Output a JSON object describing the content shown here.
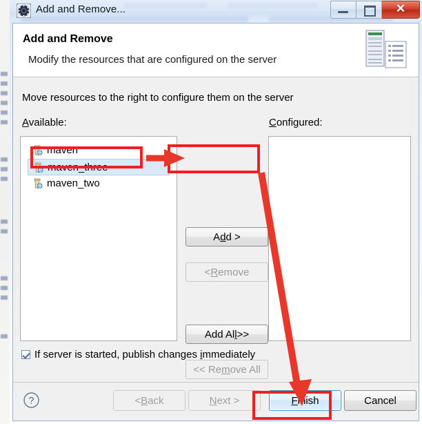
{
  "window": {
    "title": "Add and Remove...",
    "icon": "gear-icon",
    "controls": {
      "minimize": "minimize-icon",
      "maximize": "maximize-icon",
      "close": "✕"
    }
  },
  "header": {
    "title": "Add and Remove",
    "subtitle": "Modify the resources that are configured on the server",
    "icon": "server-resources-icon"
  },
  "main": {
    "instruction": "Move resources to the right to configure them on the server",
    "available": {
      "label": "Available:",
      "label_mnemonic": "A",
      "items": [
        {
          "name": "maven",
          "icon": "project-icon",
          "selected": false
        },
        {
          "name": "maven_three",
          "icon": "project-icon",
          "selected": true
        },
        {
          "name": "maven_two",
          "icon": "project-icon",
          "selected": false
        }
      ]
    },
    "configured": {
      "label": "Configured:",
      "label_mnemonic": "C",
      "items": []
    },
    "transfer_buttons": [
      {
        "label_pre": "A",
        "label_mnemonic": "d",
        "label_post": "d >",
        "full": "Add >",
        "enabled": true
      },
      {
        "label_pre": "< ",
        "label_mnemonic": "R",
        "label_post": "emove",
        "full": "< Remove",
        "enabled": false
      },
      {
        "label_pre": "Add Al",
        "label_mnemonic": "l",
        "label_post": " >>",
        "full": "Add All >>",
        "enabled": true
      },
      {
        "label_pre": "<< Re",
        "label_mnemonic": "m",
        "label_post": "ove All",
        "full": "<< Remove All",
        "enabled": false
      }
    ],
    "publish_checkbox": {
      "checked": true,
      "text_pre": "If server is started, publish changes ",
      "text_mnemonic": "i",
      "text_post": "mmediately",
      "full": "If server is started, publish changes immediately"
    }
  },
  "footer": {
    "help": "?",
    "buttons": [
      {
        "label_pre": "< ",
        "label_mnemonic": "B",
        "label_post": "ack",
        "full": "< Back",
        "enabled": false,
        "default": false
      },
      {
        "label_pre": "",
        "label_mnemonic": "N",
        "label_post": "ext >",
        "full": "Next >",
        "enabled": false,
        "default": false
      },
      {
        "label_pre": "",
        "label_mnemonic": "F",
        "label_post": "inish",
        "full": "Finish",
        "enabled": true,
        "default": true
      },
      {
        "label_pre": "Cancel",
        "label_mnemonic": "",
        "label_post": "",
        "full": "Cancel",
        "enabled": true,
        "default": false
      }
    ]
  },
  "annotations": {
    "highlight_boxes": [
      {
        "target": "maven_three list item",
        "color": "#f02020"
      },
      {
        "target": "Add > button",
        "color": "#f02020"
      },
      {
        "target": "Finish button",
        "color": "#f02020"
      }
    ],
    "arrows": [
      {
        "from": "maven_three",
        "to": "Add > button",
        "color": "#f02020"
      },
      {
        "from": "Add > button area",
        "to": "Finish button",
        "color": "#f02020"
      }
    ]
  }
}
